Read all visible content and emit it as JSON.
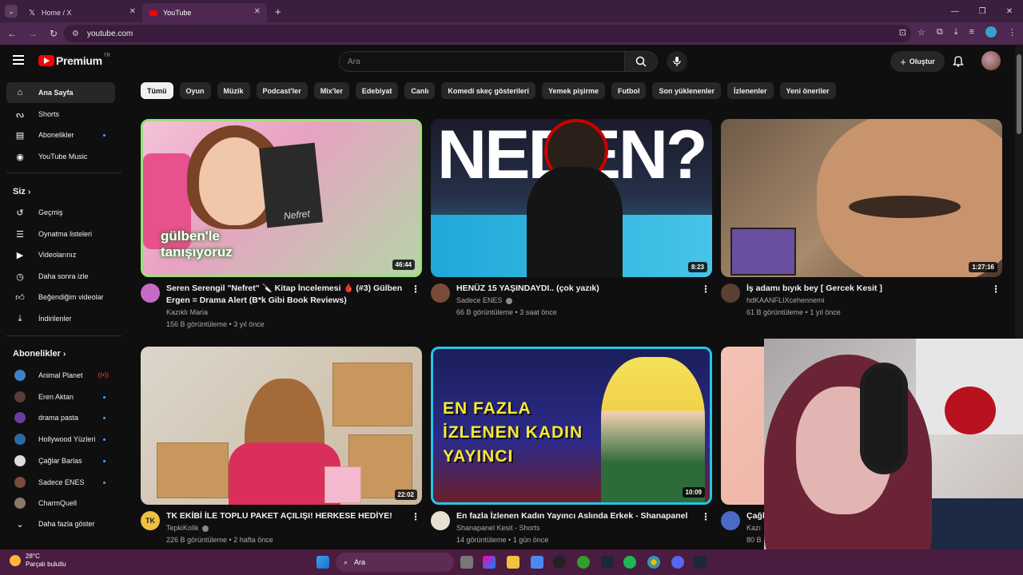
{
  "browser": {
    "tabs": [
      {
        "label": "Home / X",
        "icon": "x-logo-icon"
      },
      {
        "label": "YouTube",
        "icon": "youtube-logo-icon"
      }
    ],
    "url": "youtube.com"
  },
  "header": {
    "brand": "Premium",
    "country": "TR",
    "search_placeholder": "Ara",
    "create_label": "Oluştur"
  },
  "sidebar": {
    "main": [
      {
        "label": "Ana Sayfa",
        "icon": "home-icon",
        "active": true
      },
      {
        "label": "Shorts",
        "icon": "shorts-icon"
      },
      {
        "label": "Abonelikler",
        "icon": "subscriptions-icon",
        "dot": true
      },
      {
        "label": "YouTube Music",
        "icon": "music-icon"
      }
    ],
    "you_heading": "Siz",
    "you": [
      {
        "label": "Geçmiş",
        "icon": "history-icon"
      },
      {
        "label": "Oynatma listeleri",
        "icon": "playlist-icon"
      },
      {
        "label": "Videolarınız",
        "icon": "your-videos-icon"
      },
      {
        "label": "Daha sonra izle",
        "icon": "watch-later-icon"
      },
      {
        "label": "Beğendiğim videolar",
        "icon": "like-icon"
      },
      {
        "label": "İndirilenler",
        "icon": "download-icon"
      }
    ],
    "subs_heading": "Abonelikler",
    "subscriptions": [
      {
        "label": "Animal Planet",
        "color": "#3b83c4",
        "status": "live"
      },
      {
        "label": "Eren Aktan",
        "color": "#5a3a3a",
        "status": "dot"
      },
      {
        "label": "drama pasta",
        "color": "#6a3aa0",
        "status": "dot"
      },
      {
        "label": "Hollywood Yüzleri",
        "color": "#2a6aa8",
        "status": "dot"
      },
      {
        "label": "Çağlar Barlas",
        "color": "#dddddd",
        "status": "dot"
      },
      {
        "label": "Sadece ENES",
        "color": "#7a4a3a",
        "status": "dot"
      },
      {
        "label": "CharmQuell",
        "color": "#8a7a6a",
        "status": "none"
      }
    ],
    "more_label": "Daha fazla göster"
  },
  "chips": [
    "Tümü",
    "Oyun",
    "Müzik",
    "Podcast'ler",
    "Mix'ler",
    "Edebiyat",
    "Canlı",
    "Komedi skeç gösterileri",
    "Yemek pişirme",
    "Futbol",
    "Son yüklenenler",
    "İzlenenler",
    "Yeni öneriler"
  ],
  "videos": [
    {
      "title": "Seren Serengil \"Nefret\" 🔪 Kitap İncelemesi 🩸 (#3) Gülben Ergen = Drama Alert (B*k Gibi Book Reviews)",
      "channel": "Kazıklı Maria",
      "meta": "156 B görüntüleme • 3 yıl önce",
      "duration": "46:44",
      "thumb_text": "gülben'le tanışıyoruz",
      "thumb_book": "Nefret",
      "avatar_color": "#c66ac8",
      "verified": false
    },
    {
      "title": "HENÜZ 15 YAŞINDAYDI.. (çok yazık)",
      "channel": "Sadece ENES",
      "meta": "66 B görüntüleme • 3 saat önce",
      "duration": "8:23",
      "thumb_text": "NEDEN?",
      "avatar_color": "#7a4a3a",
      "verified": true
    },
    {
      "title": "İş adamı bıyık bey [ Gercek Kesit ]",
      "channel": "hdKAANFLIXcehennemi",
      "meta": "61 B görüntüleme • 1 yıl önce",
      "duration": "1:27:16",
      "avatar_color": "#5a4030",
      "verified": false
    },
    {
      "title": "TK EKİBİ İLE TOPLU PAKET AÇILIŞI! HERKESE HEDİYE!",
      "channel": "TepkiKolik",
      "meta": "226 B görüntüleme • 2 hafta önce",
      "duration": "22:02",
      "avatar_color": "#f0c040",
      "avatar_text": "TK",
      "verified": true
    },
    {
      "title": "En fazla İzlenen Kadın Yayıncı Aslında Erkek - Shanapanel",
      "channel": "Shanapanel Kesit - Shorts",
      "meta": "14 görüntüleme • 1 gün önce",
      "duration": "10:09",
      "thumb_text": "EN FAZLA İZLENEN KADIN YAYINCI",
      "avatar_color": "#e8e0d0",
      "verified": false
    },
    {
      "title": "Çağl",
      "channel": "Kazı",
      "meta": "80 B",
      "avatar_color": "#4a6ac8",
      "verified": false
    }
  ],
  "taskbar": {
    "temp": "28°C",
    "weather": "Parçalı bulutlu",
    "search": "Ara"
  }
}
